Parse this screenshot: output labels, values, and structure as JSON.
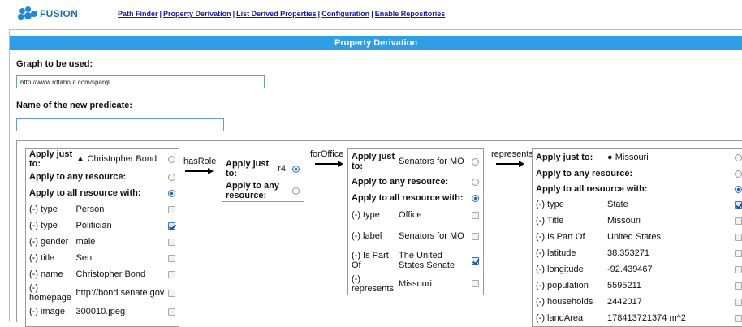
{
  "logo": {
    "text": "FUSION"
  },
  "nav": {
    "links": [
      "Path Finder",
      "Property Derivation",
      "List Derived Properties",
      "Configuration",
      "Enable Repositories"
    ],
    "separator": "|"
  },
  "header": {
    "title": "Property Derivation"
  },
  "form": {
    "graph_label": "Graph to be used:",
    "graph_value": "http://www.rdfabout.com/sparql",
    "predicate_label": "Name of the new predicate:",
    "predicate_value": ""
  },
  "nodes": [
    {
      "just_label": "Apply just to:",
      "just_marker": "▲",
      "just_value": "Christopher Bond",
      "just_selected": false,
      "any_label": "Apply to any resource:",
      "any_selected": false,
      "all_label": "Apply to all resource with:",
      "all_selected": true,
      "rows": [
        {
          "prop": "(-) type",
          "value": "Person",
          "checked": false
        },
        {
          "prop": "(-) type",
          "value": "Politician",
          "checked": true
        },
        {
          "prop": "(-) gender",
          "value": "male",
          "checked": false
        },
        {
          "prop": "(-) title",
          "value": "Sen.",
          "checked": false
        },
        {
          "prop": "(-) name",
          "value": "Christopher Bond",
          "checked": false
        },
        {
          "prop": "(-) homepage",
          "value": "http://bond.senate.gov",
          "checked": false
        },
        {
          "prop": "(-) image",
          "value": "300010.jpeg",
          "checked": false
        }
      ]
    },
    {
      "just_label": "Apply just to:",
      "just_value": "r4",
      "just_selected": true,
      "any_label": "Apply to any resource:",
      "any_selected": false
    },
    {
      "just_label": "Apply just to:",
      "just_value": "Senators for MO",
      "just_selected": false,
      "any_label": "Apply to any resource:",
      "any_selected": false,
      "all_label": "Apply to all resource with:",
      "all_selected": true,
      "rows": [
        {
          "prop": "(-) type",
          "value": "Office",
          "checked": false
        },
        {
          "prop": "(-) label",
          "value": "Senators for MO",
          "checked": false
        },
        {
          "prop": "(-) Is Part Of",
          "value": "The United States Senate",
          "checked": true
        },
        {
          "prop": "(-) represents",
          "value": "Missouri",
          "checked": false
        }
      ]
    },
    {
      "just_label": "Apply just to:",
      "just_marker": "●",
      "just_value": "Missouri",
      "just_selected": false,
      "any_label": "Apply to any resource:",
      "any_selected": false,
      "all_label": "Apply to all resource with:",
      "all_selected": true,
      "rows": [
        {
          "prop": "(-) type",
          "value": "State",
          "checked": true
        },
        {
          "prop": "(-) Title",
          "value": "Missouri",
          "checked": false
        },
        {
          "prop": "(-) Is Part Of",
          "value": "United States",
          "checked": false
        },
        {
          "prop": "(-) latitude",
          "value": "38.353271",
          "checked": false
        },
        {
          "prop": "(-) longitude",
          "value": "-92.439467",
          "checked": false
        },
        {
          "prop": "(-) population",
          "value": "5595211",
          "checked": false
        },
        {
          "prop": "(-) households",
          "value": "2442017",
          "checked": false
        },
        {
          "prop": "(-) landArea",
          "value": "178413721374 m^2",
          "checked": false
        }
      ]
    }
  ],
  "edges": [
    "hasRole",
    "forOffice",
    "represents"
  ],
  "colors": {
    "header_bar": "#2e9ee6",
    "link": "#1a1aa6",
    "logo": "#1e88d6"
  }
}
